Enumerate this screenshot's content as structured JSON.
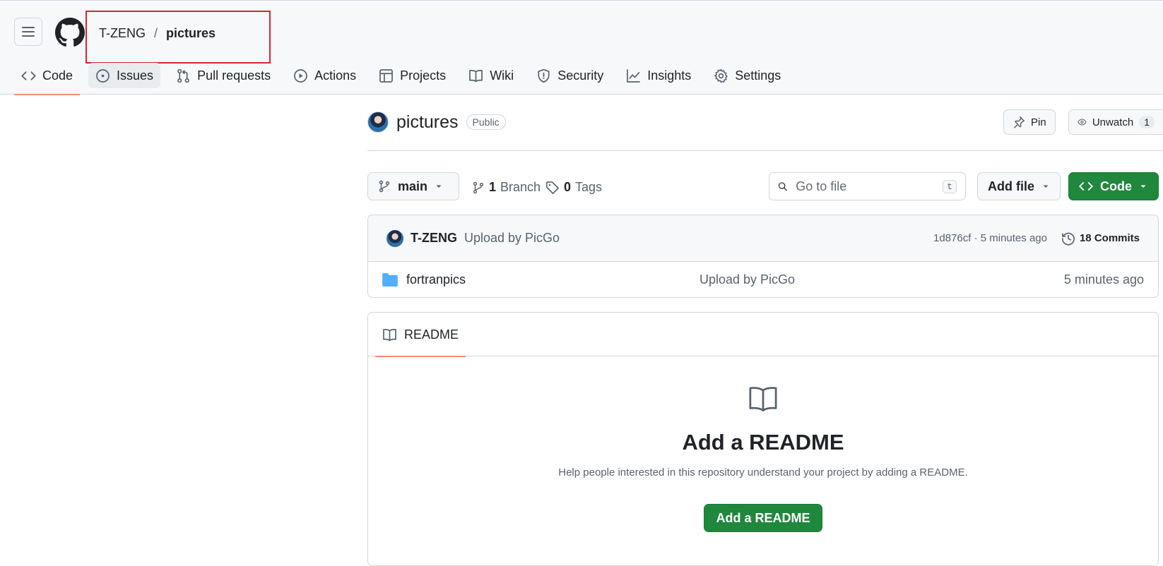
{
  "breadcrumb": {
    "owner": "T-ZENG",
    "separator": "/",
    "repo": "pictures"
  },
  "tabs": [
    {
      "label": "Code",
      "icon": "code-icon"
    },
    {
      "label": "Issues",
      "icon": "issue-opened-icon"
    },
    {
      "label": "Pull requests",
      "icon": "git-pull-request-icon"
    },
    {
      "label": "Actions",
      "icon": "play-icon"
    },
    {
      "label": "Projects",
      "icon": "table-icon"
    },
    {
      "label": "Wiki",
      "icon": "book-icon"
    },
    {
      "label": "Security",
      "icon": "shield-icon"
    },
    {
      "label": "Insights",
      "icon": "graph-icon"
    },
    {
      "label": "Settings",
      "icon": "gear-icon"
    }
  ],
  "repo": {
    "name": "pictures",
    "visibility": "Public",
    "pin_label": "Pin",
    "unwatch_label": "Unwatch",
    "watch_count": "1"
  },
  "toolbar": {
    "branch": "main",
    "branches_count": "1",
    "branches_label": "Branch",
    "tags_count": "0",
    "tags_label": "Tags",
    "search_placeholder": "Go to file",
    "search_shortcut": "t",
    "add_file_label": "Add file",
    "code_label": "Code"
  },
  "latest_commit": {
    "author": "T-ZENG",
    "message": "Upload by PicGo",
    "meta": "1d876cf · 5 minutes ago",
    "commits_label": "18 Commits"
  },
  "files": [
    {
      "name": "fortranpics",
      "message": "Upload by PicGo",
      "time": "5 minutes ago",
      "icon": "folder-icon"
    }
  ],
  "readme": {
    "tab_label": "README",
    "title": "Add a README",
    "description": "Help people interested in this repository understand your project by adding a README.",
    "button_label": "Add a README"
  },
  "colors": {
    "accent_underline": "#fd8c73",
    "primary_green": "#1f883d",
    "folder_blue": "#54aeff",
    "highlight_red": "#d7262e"
  }
}
